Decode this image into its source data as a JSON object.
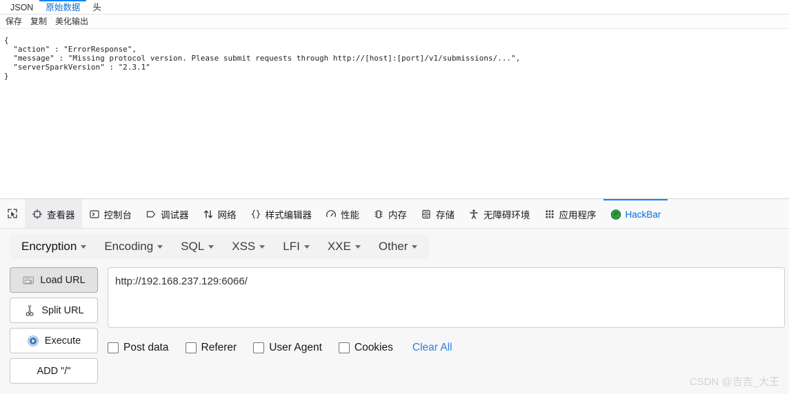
{
  "response_panel": {
    "tabs": [
      {
        "label": "JSON",
        "active": false
      },
      {
        "label": "原始数据",
        "active": true
      },
      {
        "label": "头",
        "active": false
      }
    ],
    "actions": [
      {
        "label": "保存"
      },
      {
        "label": "复制"
      },
      {
        "label": "美化输出"
      }
    ],
    "json_text": "{\n  \"action\" : \"ErrorResponse\",\n  \"message\" : \"Missing protocol version. Please submit requests through http://[host]:[port]/v1/submissions/...\",\n  \"serverSparkVersion\" : \"2.3.1\"\n}"
  },
  "devtools": {
    "picker_icon": "inspector-picker-icon",
    "tabs": [
      {
        "label": "查看器",
        "icon": "inspector-icon",
        "active": false,
        "hovered": true
      },
      {
        "label": "控制台",
        "icon": "console-icon",
        "active": false,
        "hovered": false
      },
      {
        "label": "调试器",
        "icon": "debugger-icon",
        "active": false,
        "hovered": false
      },
      {
        "label": "网络",
        "icon": "network-icon",
        "active": false,
        "hovered": false
      },
      {
        "label": "样式编辑器",
        "icon": "style-editor-icon",
        "active": false,
        "hovered": false
      },
      {
        "label": "性能",
        "icon": "performance-icon",
        "active": false,
        "hovered": false
      },
      {
        "label": "内存",
        "icon": "memory-icon",
        "active": false,
        "hovered": false
      },
      {
        "label": "存储",
        "icon": "storage-icon",
        "active": false,
        "hovered": false
      },
      {
        "label": "无障碍环境",
        "icon": "accessibility-icon",
        "active": false,
        "hovered": false
      },
      {
        "label": "应用程序",
        "icon": "application-icon",
        "active": false,
        "hovered": false
      },
      {
        "label": "HackBar",
        "icon": "hackbar-icon",
        "active": true,
        "hovered": false
      }
    ],
    "active_accent_color": "#0a84ff"
  },
  "hackbar": {
    "menus": [
      {
        "label": "Encryption"
      },
      {
        "label": "Encoding"
      },
      {
        "label": "SQL"
      },
      {
        "label": "XSS"
      },
      {
        "label": "LFI"
      },
      {
        "label": "XXE"
      },
      {
        "label": "Other"
      }
    ],
    "buttons": [
      {
        "label": "Load URL",
        "icon": "load-url-icon",
        "pressed": true
      },
      {
        "label": "Split URL",
        "icon": "scissors-icon",
        "pressed": false
      },
      {
        "label": "Execute",
        "icon": "play-icon",
        "pressed": false
      },
      {
        "label": "ADD \"/\"",
        "icon": "",
        "pressed": false
      }
    ],
    "url_value": "http://192.168.237.129:6066/",
    "url_placeholder": "",
    "options": [
      {
        "label": "Post data",
        "checked": false
      },
      {
        "label": "Referer",
        "checked": false
      },
      {
        "label": "User Agent",
        "checked": false
      },
      {
        "label": "Cookies",
        "checked": false
      }
    ],
    "clear_all_label": "Clear All",
    "link_color": "#2f7fe0"
  },
  "watermark": {
    "text": "CSDN @吉吉_大王"
  }
}
